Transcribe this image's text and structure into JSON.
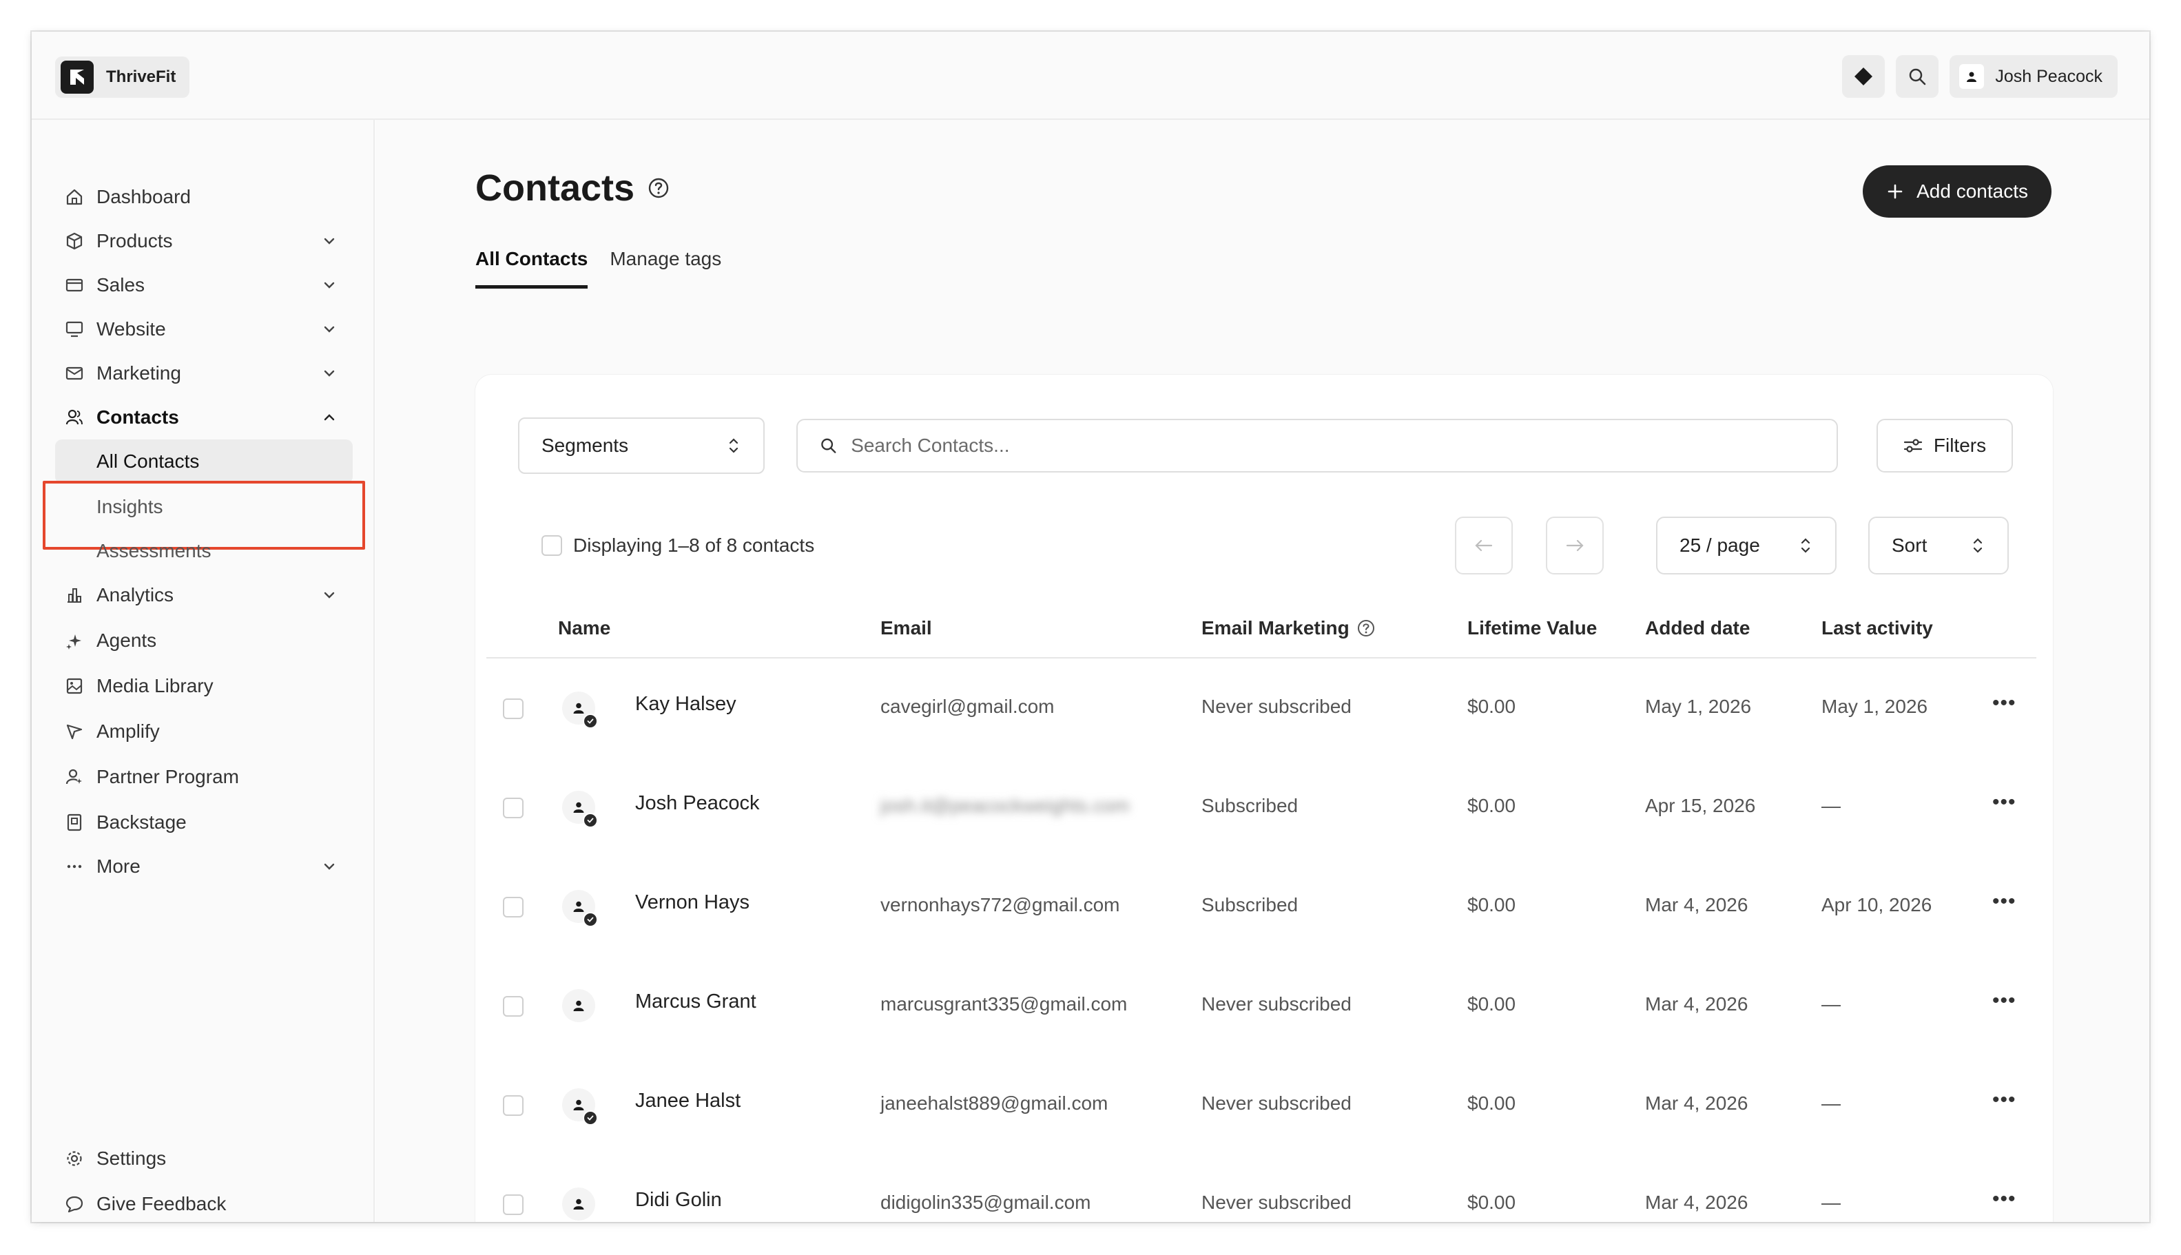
{
  "app": {
    "brand": "ThriveFit",
    "user": "Josh Peacock"
  },
  "sidebar": {
    "items": [
      {
        "label": "Dashboard",
        "icon": "home-icon"
      },
      {
        "label": "Products",
        "icon": "box-icon"
      },
      {
        "label": "Sales",
        "icon": "card-icon"
      },
      {
        "label": "Website",
        "icon": "monitor-icon"
      },
      {
        "label": "Marketing",
        "icon": "mail-icon"
      },
      {
        "label": "Contacts",
        "icon": "users-icon"
      },
      {
        "label": "All Contacts"
      },
      {
        "label": "Insights"
      },
      {
        "label": "Assessments"
      },
      {
        "label": "Analytics",
        "icon": "chart-icon"
      },
      {
        "label": "Agents",
        "icon": "sparkle-icon"
      },
      {
        "label": "Media Library",
        "icon": "image-icon"
      },
      {
        "label": "Amplify",
        "icon": "megaphone-icon"
      },
      {
        "label": "Partner Program",
        "icon": "partner-icon"
      },
      {
        "label": "Backstage",
        "icon": "backstage-icon"
      },
      {
        "label": "More",
        "icon": "more-icon"
      }
    ],
    "footer": [
      {
        "label": "Settings",
        "icon": "gear-icon"
      },
      {
        "label": "Give Feedback",
        "icon": "chat-icon"
      }
    ]
  },
  "main": {
    "title": "Contacts",
    "add_button": "Add contacts",
    "tabs": [
      "All Contacts",
      "Manage tags"
    ],
    "segments_label": "Segments",
    "search_placeholder": "Search Contacts...",
    "filters_label": "Filters",
    "displaying": "Displaying 1–8 of 8 contacts",
    "per_page": "25 / page",
    "sort_label": "Sort",
    "columns": [
      "Name",
      "Email",
      "Email Marketing",
      "Lifetime Value",
      "Added date",
      "Last activity"
    ],
    "rows": [
      {
        "name": "Kay Halsey",
        "email": "cavegirl@gmail.com",
        "marketing": "Never subscribed",
        "ltv": "$0.00",
        "added": "May 1, 2026",
        "last": "May 1, 2026",
        "verified": true
      },
      {
        "name": "Josh Peacock",
        "email": "josh.it@peacockweights.com",
        "marketing": "Subscribed",
        "ltv": "$0.00",
        "added": "Apr 15, 2026",
        "last": "—",
        "verified": true
      },
      {
        "name": "Vernon Hays",
        "email": "vernonhays772@gmail.com",
        "marketing": "Subscribed",
        "ltv": "$0.00",
        "added": "Mar 4, 2026",
        "last": "Apr 10, 2026",
        "verified": true
      },
      {
        "name": "Marcus Grant",
        "email": "marcusgrant335@gmail.com",
        "marketing": "Never subscribed",
        "ltv": "$0.00",
        "added": "Mar 4, 2026",
        "last": "—",
        "verified": false
      },
      {
        "name": "Janee Halst",
        "email": "janeehalst889@gmail.com",
        "marketing": "Never subscribed",
        "ltv": "$0.00",
        "added": "Mar 4, 2026",
        "last": "—",
        "verified": true
      },
      {
        "name": "Didi Golin",
        "email": "didigolin335@gmail.com",
        "marketing": "Never subscribed",
        "ltv": "$0.00",
        "added": "Mar 4, 2026",
        "last": "—",
        "verified": false
      }
    ]
  },
  "colors": {
    "accent": "#242424",
    "highlight": "#e5472d"
  }
}
